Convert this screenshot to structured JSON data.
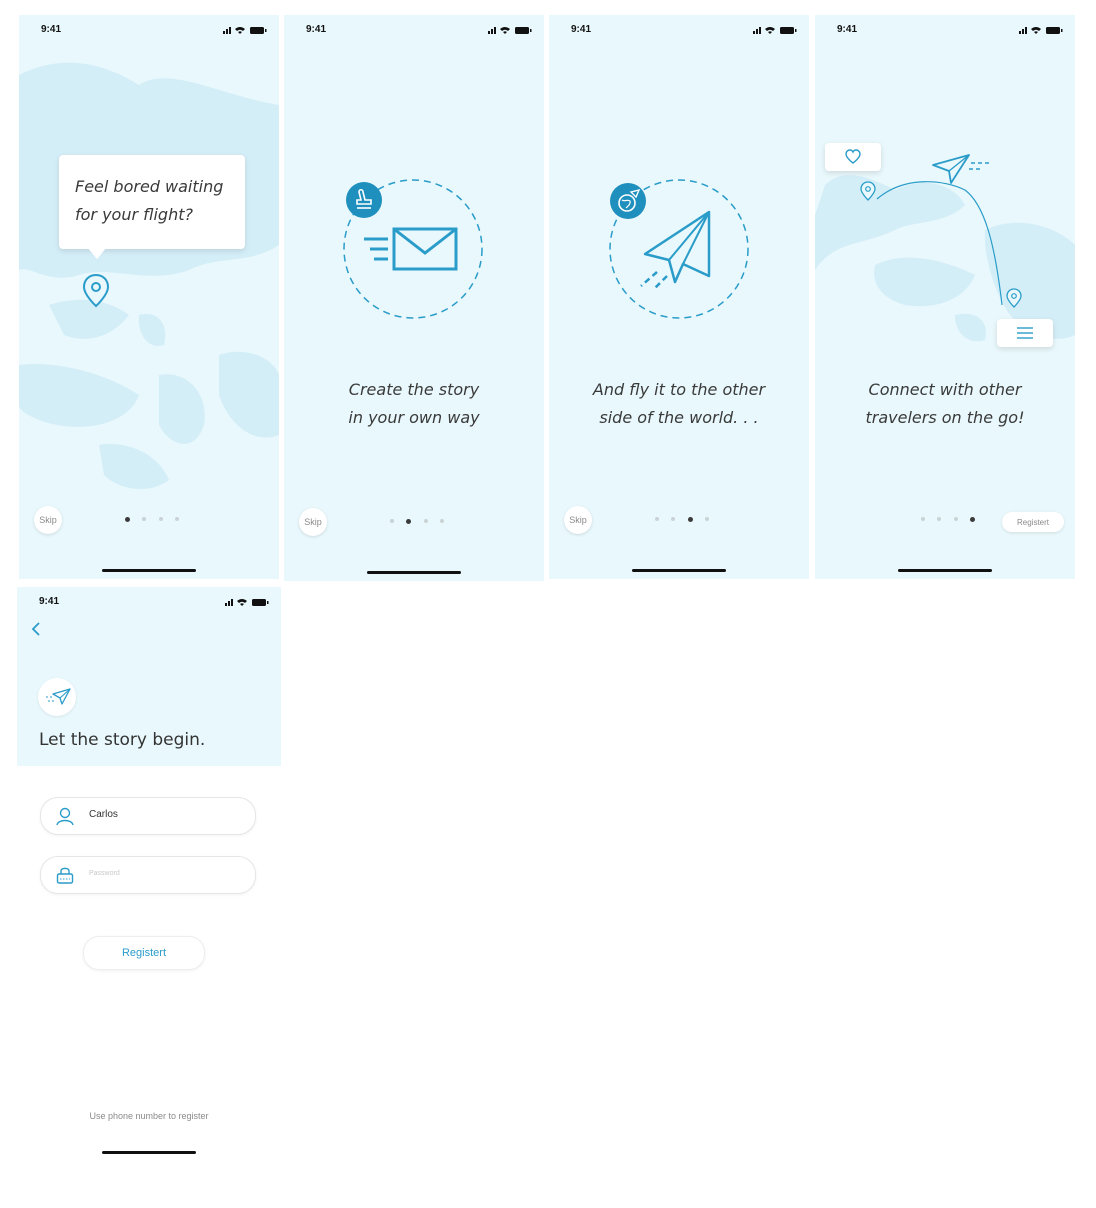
{
  "colors": {
    "screen_bg": "#e9f8fc",
    "map_land": "#d4eef8",
    "accent": "#2a9cc9",
    "text_dark": "#3a3a3a",
    "dot_inactive": "#c9d3d6",
    "dot_active": "#3b3b3b"
  },
  "status_bar": {
    "time": "9:41"
  },
  "screens": [
    {
      "bubble_line1": "Feel bored waiting",
      "bubble_line2": "for your flight?",
      "skip": "Skip",
      "active_dot": 1,
      "icon": "location-pin-icon"
    },
    {
      "caption_line1": "Create the story",
      "caption_line2": "in your own way",
      "skip": "Skip",
      "active_dot": 2,
      "icon": "envelope-icon",
      "badge_icon": "stamp-icon"
    },
    {
      "caption_line1": "And fly it to the other",
      "caption_line2": "side of the world. . .",
      "skip": "Skip",
      "active_dot": 3,
      "icon": "paper-plane-icon",
      "badge_icon": "globe-plane-icon"
    },
    {
      "caption_line1": "Connect with other",
      "caption_line2": "travelers on the go!",
      "register": "Registert",
      "active_dot": 4,
      "icons": [
        "heart-icon",
        "paper-plane-icon",
        "menu-icon",
        "location-pin-icon"
      ]
    }
  ],
  "register_screen": {
    "back_icon": "chevron-left-icon",
    "logo_icon": "paper-plane-icon",
    "title": "Let the story begin.",
    "username_value": "Carlos",
    "username_icon": "user-icon",
    "password_placeholder": "Password",
    "password_icon": "lock-icon",
    "register_button": "Registert",
    "phone_link": "Use phone number to register"
  }
}
